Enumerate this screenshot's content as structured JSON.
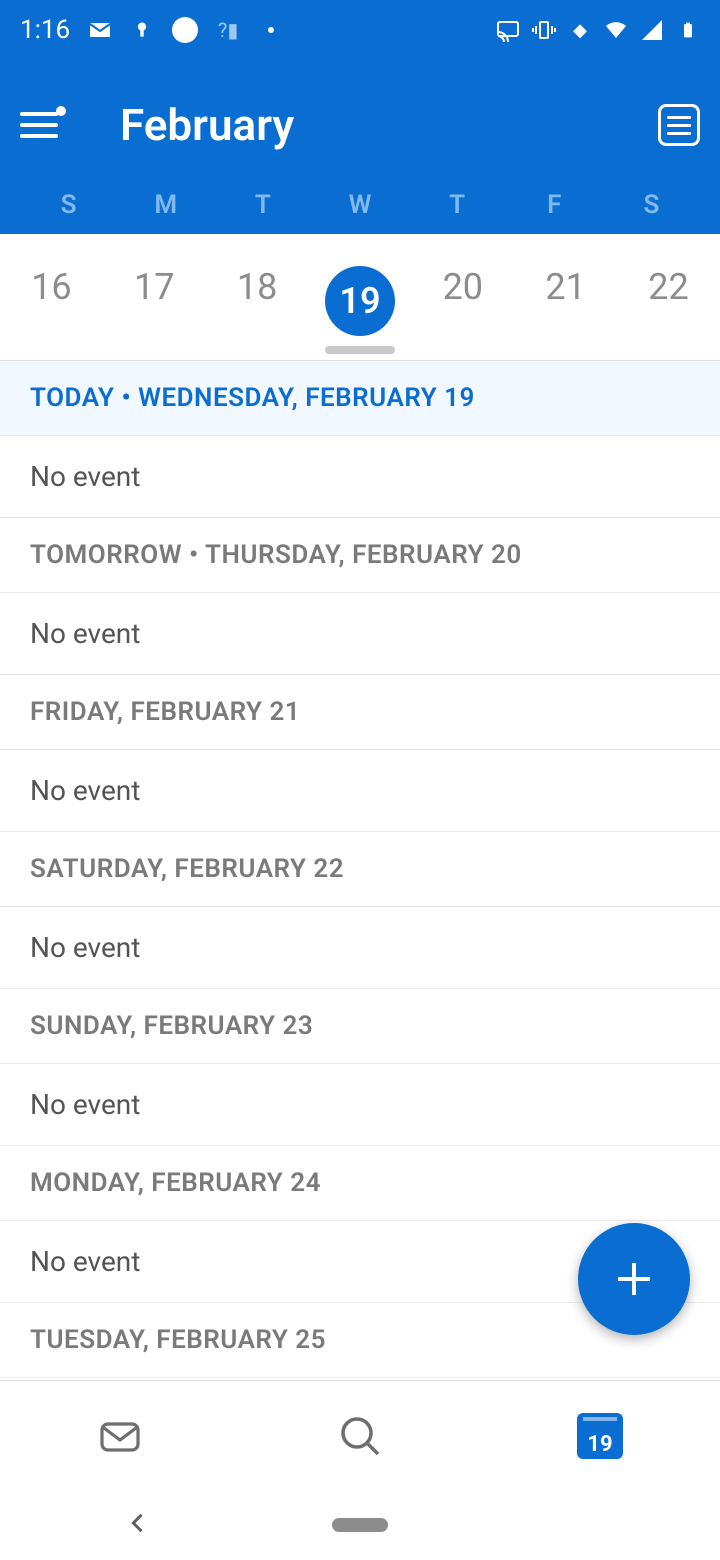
{
  "status": {
    "time": "1:16"
  },
  "header": {
    "month": "February"
  },
  "weekdays": [
    "S",
    "M",
    "T",
    "W",
    "T",
    "F",
    "S"
  ],
  "days": [
    {
      "num": "16",
      "selected": false
    },
    {
      "num": "17",
      "selected": false
    },
    {
      "num": "18",
      "selected": false
    },
    {
      "num": "19",
      "selected": true
    },
    {
      "num": "20",
      "selected": false
    },
    {
      "num": "21",
      "selected": false
    },
    {
      "num": "22",
      "selected": false
    }
  ],
  "agenda": [
    {
      "header": "TODAY • WEDNESDAY, FEBRUARY 19",
      "today": true,
      "event": "No event"
    },
    {
      "header": "TOMORROW • THURSDAY, FEBRUARY 20",
      "today": false,
      "event": "No event"
    },
    {
      "header": "FRIDAY, FEBRUARY 21",
      "today": false,
      "event": "No event"
    },
    {
      "header": "SATURDAY, FEBRUARY 22",
      "today": false,
      "event": "No event"
    },
    {
      "header": "SUNDAY, FEBRUARY 23",
      "today": false,
      "event": "No event"
    },
    {
      "header": "MONDAY, FEBRUARY 24",
      "today": false,
      "event": "No event"
    },
    {
      "header": "TUESDAY, FEBRUARY 25",
      "today": false,
      "event": ""
    }
  ],
  "bottomNav": {
    "calendarDay": "19"
  }
}
